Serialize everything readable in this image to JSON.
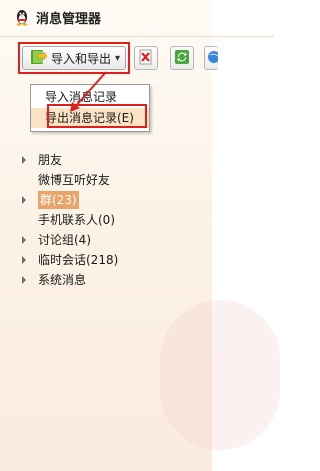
{
  "window": {
    "title": "消息管理器"
  },
  "toolbar": {
    "import_export_label": "导入和导出",
    "chevron": "▾"
  },
  "menu": {
    "items": [
      {
        "label": "导入消息记录"
      },
      {
        "label": "导出消息记录(E)"
      }
    ]
  },
  "tree": {
    "items": [
      {
        "label": "朋友",
        "expandable": true
      },
      {
        "label": "微博互听好友",
        "expandable": false
      },
      {
        "label": "群(23)",
        "expandable": true,
        "selected": true
      },
      {
        "label": "手机联系人(0)",
        "expandable": false
      },
      {
        "label": "讨论组(4)",
        "expandable": true
      },
      {
        "label": "临时会话(218)",
        "expandable": true
      },
      {
        "label": "系统消息",
        "expandable": true
      }
    ]
  },
  "colors": {
    "highlight_box": "#e0201c",
    "selected_item": "#e8a56a",
    "menu_hover": "#fbe4c4"
  }
}
